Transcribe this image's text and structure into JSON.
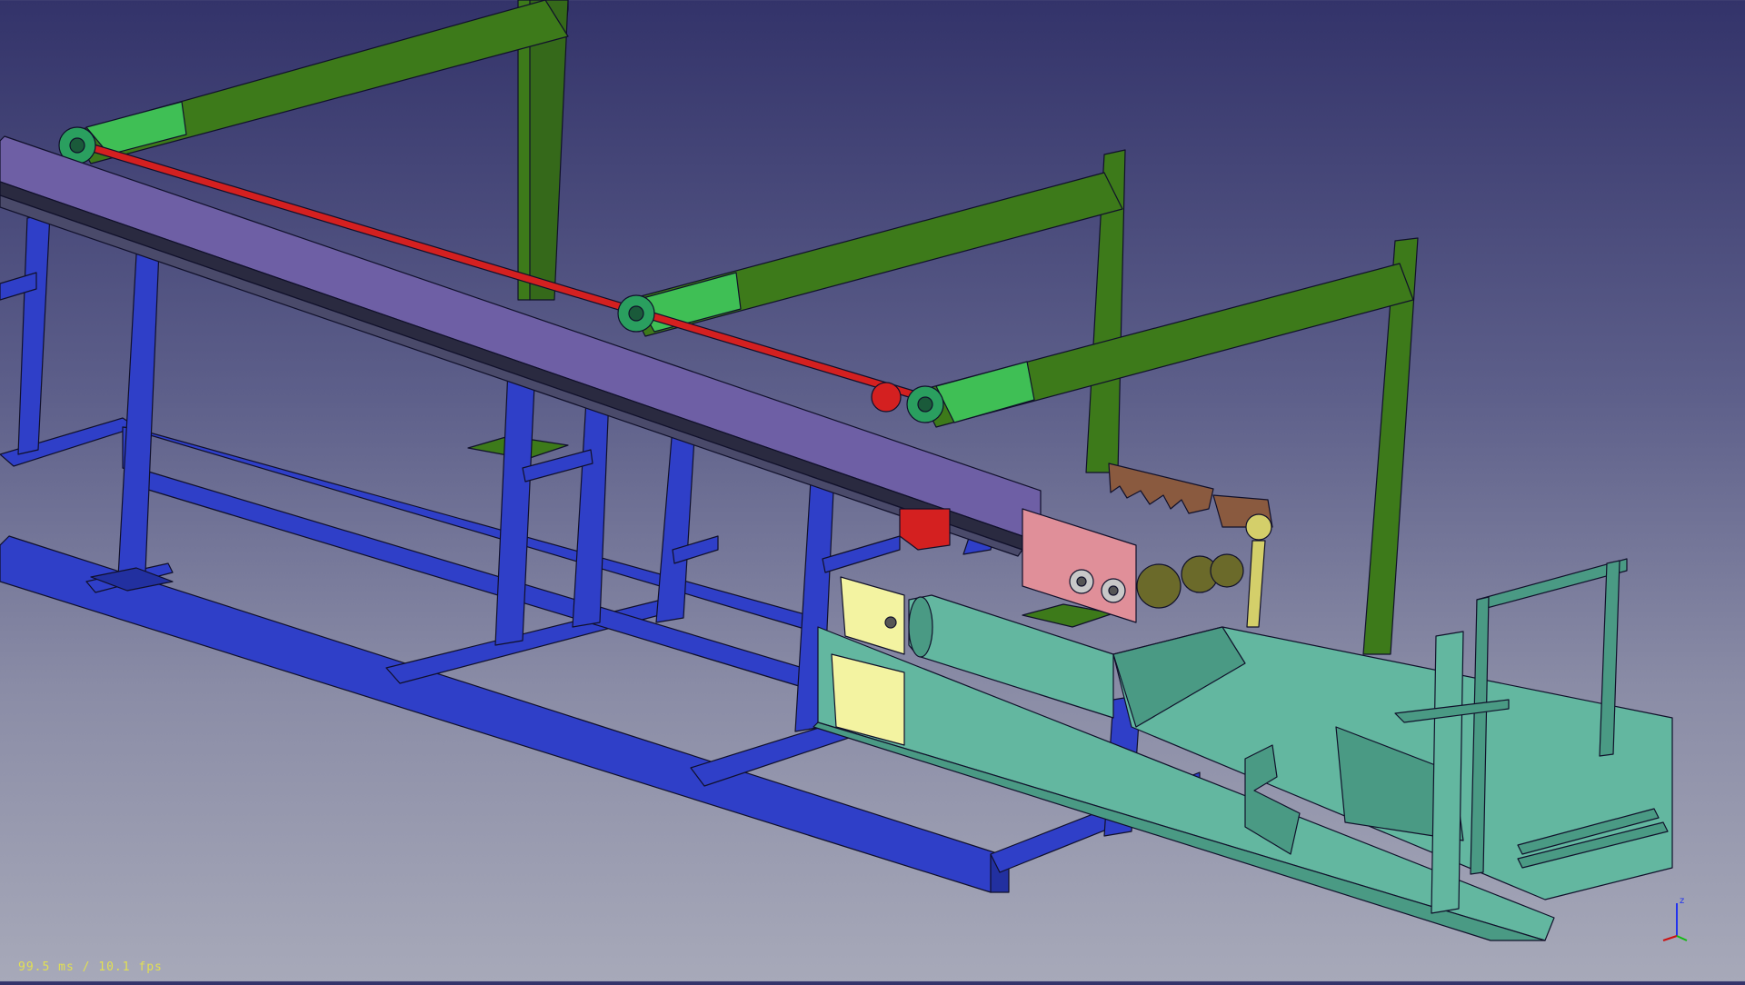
{
  "viewport": {
    "fps_text": "99.5 ms / 10.1 fps",
    "axis_label_z": "z",
    "colors": {
      "frame_blue": "#2f3fc8",
      "support_green": "#3d7a1a",
      "bracket_green": "#3fbf55",
      "beam_purple": "#6e5fa5",
      "shaft_red": "#d42020",
      "splitter_teal": "#63b7a0",
      "plate_yellow": "#f3f3a1",
      "block_pink": "#e08f99",
      "saw_brown": "#8a5a3f",
      "fps_yellow": "#e2e052"
    }
  }
}
